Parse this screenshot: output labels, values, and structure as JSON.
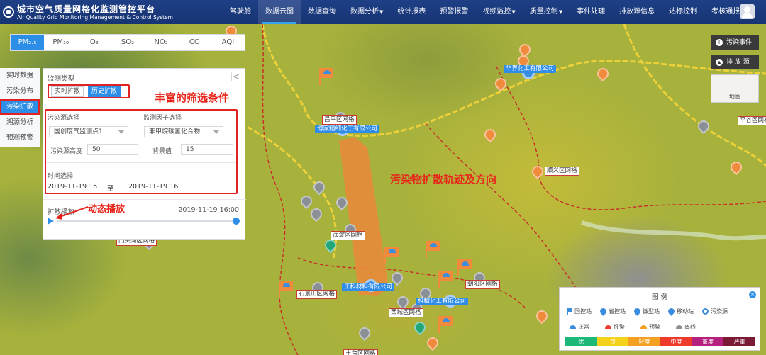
{
  "header": {
    "title_cn": "城市空气质量网格化监测管控平台",
    "title_en": "Air Quality Grid Monitoring Management & Control System",
    "nav": [
      {
        "label": "驾驶舱",
        "dropdown": false
      },
      {
        "label": "数据云图",
        "dropdown": false,
        "active": true
      },
      {
        "label": "数据查询",
        "dropdown": false
      },
      {
        "label": "数据分析",
        "dropdown": true
      },
      {
        "label": "统计报表",
        "dropdown": false
      },
      {
        "label": "预警报警",
        "dropdown": false
      },
      {
        "label": "视频监控",
        "dropdown": true
      },
      {
        "label": "质量控制",
        "dropdown": true
      },
      {
        "label": "事件处理",
        "dropdown": false
      },
      {
        "label": "排放源信息",
        "dropdown": false
      },
      {
        "label": "达标控制",
        "dropdown": false
      },
      {
        "label": "考核通报",
        "dropdown": true
      }
    ]
  },
  "pollutant_tabs": [
    {
      "label": "PM₂.₅",
      "active": true
    },
    {
      "label": "PM₁₀"
    },
    {
      "label": "O₃"
    },
    {
      "label": "SO₂"
    },
    {
      "label": "NO₂"
    },
    {
      "label": "CO"
    },
    {
      "label": "AQI"
    }
  ],
  "side_menu": [
    {
      "label": "实时数据"
    },
    {
      "label": "污染分布"
    },
    {
      "label": "污染扩散",
      "active": true
    },
    {
      "label": "溯源分析"
    },
    {
      "label": "预测预警"
    }
  ],
  "panel": {
    "monitor_type_label": "监测类型",
    "mode_realtime": "实时扩散",
    "mode_history": "历史扩散",
    "source_select_label": "污染源选择",
    "source_select_value": "国创废气监测点1",
    "factor_select_label": "监测因子选择",
    "factor_select_value": "非甲烷碳氢化合物",
    "height_label": "污染源高度",
    "height_value": "50",
    "background_label": "背景值",
    "background_value": "15",
    "time_label": "时间选择",
    "time_start": "2019-11-19 15",
    "time_sep": "至",
    "time_end": "2019-11-19 16",
    "playback_label": "扩散播放",
    "playback_time": "2019-11-19 16:00",
    "playback_progress": 1.0
  },
  "annotations": {
    "filters": "丰富的筛选条件",
    "trajectory": "污染物扩散轨迹及方向",
    "playback": "动态播放"
  },
  "map": {
    "grid_labels": {
      "changping": "昌平区网格",
      "shunyi": "顺义区网格",
      "pinggu": "平谷区网格",
      "mentougou": "门头沟区网格",
      "haidian": "海淀区网格",
      "shijingshan": "石景山区网格",
      "chaoyang": "朝阳区网格",
      "xicheng": "西城区网格",
      "fengtai": "丰台区网格"
    },
    "company_labels": {
      "huajie": "华界化工有限公司",
      "bojia": "博家精细化工有限公司",
      "gongke": "工科材料有限公司",
      "kejing": "科精化工有限公司"
    }
  },
  "right_controls": {
    "pollution_event": "污染事件",
    "emission_source": "排 放 源",
    "basemap": "地图"
  },
  "legend": {
    "title": "图 例",
    "station_types": [
      "国控站",
      "省控站",
      "微型站",
      "移动站",
      "污染源"
    ],
    "status_types": [
      "正常",
      "报警",
      "预警",
      "离线"
    ],
    "aqi_levels": [
      {
        "label": "优",
        "color": "#1cb877"
      },
      {
        "label": "良",
        "color": "#f5d21c"
      },
      {
        "label": "轻度",
        "color": "#f4a020"
      },
      {
        "label": "中度",
        "color": "#ef3b2c"
      },
      {
        "label": "重度",
        "color": "#b5227e"
      },
      {
        "label": "严重",
        "color": "#7b1a34"
      }
    ]
  },
  "colors": {
    "accent": "#2c8ee6",
    "header": "#1f3f86",
    "annotation": "#e8251b",
    "plume": "#e88a3a"
  }
}
